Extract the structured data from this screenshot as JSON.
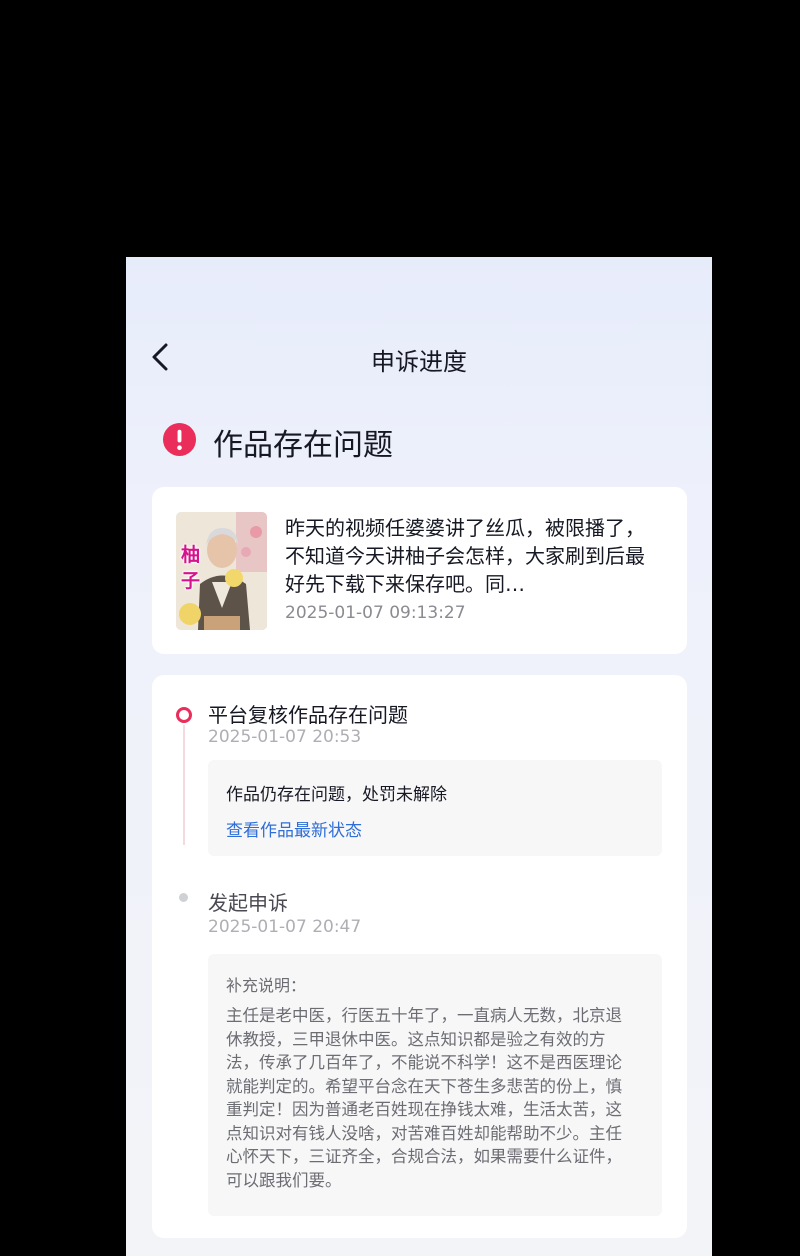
{
  "nav": {
    "title": "申诉进度"
  },
  "status": {
    "title": "作品存在问题",
    "icon": "alert-circle-icon",
    "color": "#ea2d5a"
  },
  "work": {
    "thumb_text": "柚子",
    "description": "昨天的视频任婆婆讲了丝瓜，被限播了，不知道今天讲柚子会怎样，大家刷到后最好先下载下来保存吧。同…",
    "time": "2025-01-07 09:13:27"
  },
  "timeline": {
    "items": [
      {
        "title": "平台复核作品存在问题",
        "time": "2025-01-07 20:53",
        "message": "作品仍存在问题，处罚未解除",
        "link": "查看作品最新状态"
      },
      {
        "title": "发起申诉",
        "time": "2025-01-07 20:47",
        "note_label": "补充说明：",
        "note": "主任是老中医，行医五十年了，一直病人无数，北京退休教授，三甲退休中医。这点知识都是验之有效的方法，传承了几百年了，不能说不科学！这不是西医理论就能判定的。希望平台念在天下苍生多悲苦的份上，慎重判定！因为普通老百姓现在挣钱太难，生活太苦，这点知识对有钱人没啥，对苦难百姓却能帮助不少。主任心怀天下，三证齐全，合规合法，如果需要什么证件，可以跟我们要。"
      }
    ]
  },
  "colors": {
    "accent": "#ea2d5a",
    "link": "#2f6ed8"
  }
}
